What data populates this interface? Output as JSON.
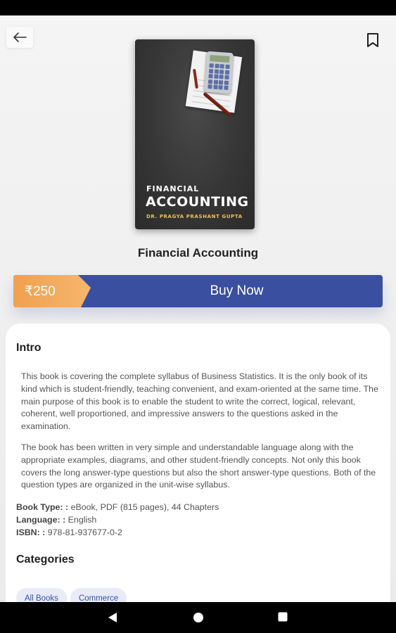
{
  "header": {
    "back_icon": "arrow-left-icon",
    "bookmark_icon": "bookmark-icon"
  },
  "cover": {
    "title_small": "FINANCIAL",
    "title_big": "ACCOUNTING",
    "author": "DR. PRAGYA PRASHANT GUPTA"
  },
  "book": {
    "title": "Financial Accounting"
  },
  "purchase": {
    "price": "₹250",
    "buy_label": "Buy Now",
    "accent_color": "#3a4fa0",
    "price_color": "#f6b66c"
  },
  "intro": {
    "heading": "Intro",
    "paragraph1": "This book is covering the complete syllabus of Business Statistics. It is the only book of its kind which is student-friendly, teaching convenient, and exam-oriented at the same time. The main purpose of this book is to enable the student to write the correct, logical, relevant, coherent, well proportioned, and impressive answers to the questions asked in the examination.",
    "paragraph2": "The book has been written in very simple and understandable language along with the appropriate examples, diagrams, and other student-friendly concepts. Not only this book covers the long answer-type questions but also the short answer-type questions. Both of the question types are organized in the unit-wise syllabus."
  },
  "details": {
    "book_type_label": "Book Type: :",
    "book_type_value": "eBook, PDF (815 pages), 44 Chapters",
    "language_label": "Language: :",
    "language_value": "English",
    "isbn_label": "ISBN: :",
    "isbn_value": "978-81-937677-0-2"
  },
  "categories": {
    "heading": "Categories",
    "items": [
      {
        "label": "All Books"
      },
      {
        "label": "Commerce"
      }
    ]
  },
  "system_nav": {
    "back_icon": "nav-back-triangle-icon",
    "home_icon": "nav-home-circle-icon",
    "recents_icon": "nav-recents-square-icon"
  }
}
